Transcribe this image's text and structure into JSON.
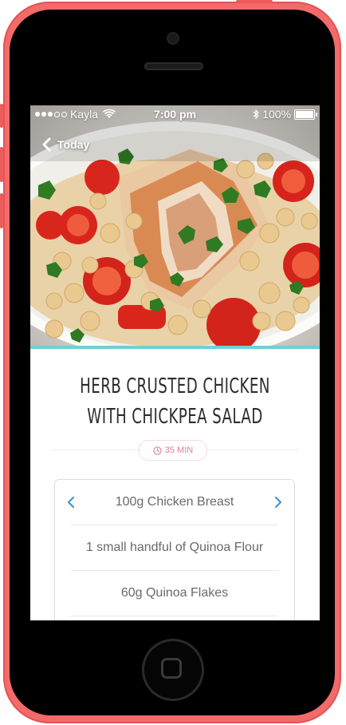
{
  "status_bar": {
    "carrier": "Kayla",
    "time": "7:00 pm",
    "battery": "100%"
  },
  "nav": {
    "back_label": "Today"
  },
  "recipe": {
    "title": "HERB CRUSTED CHICKEN WITH CHICKPEA SALAD",
    "time": "35 MIN"
  },
  "ingredients": [
    {
      "label": "100g Chicken Breast"
    },
    {
      "label": "1 small handful of Quinoa Flour"
    },
    {
      "label": "60g Quinoa Flakes"
    }
  ],
  "colors": {
    "phone_body": "#f26a6a",
    "accent_blue": "#3a8fd6",
    "time_badge": "#e07f95",
    "hero_strip": "#6fd0d4"
  },
  "icons": {
    "back": "chevron-left-icon",
    "prev": "chevron-left-icon",
    "next": "chevron-right-icon",
    "clock": "clock-icon",
    "wifi": "wifi-icon",
    "bluetooth": "bluetooth-icon",
    "battery": "battery-icon"
  }
}
